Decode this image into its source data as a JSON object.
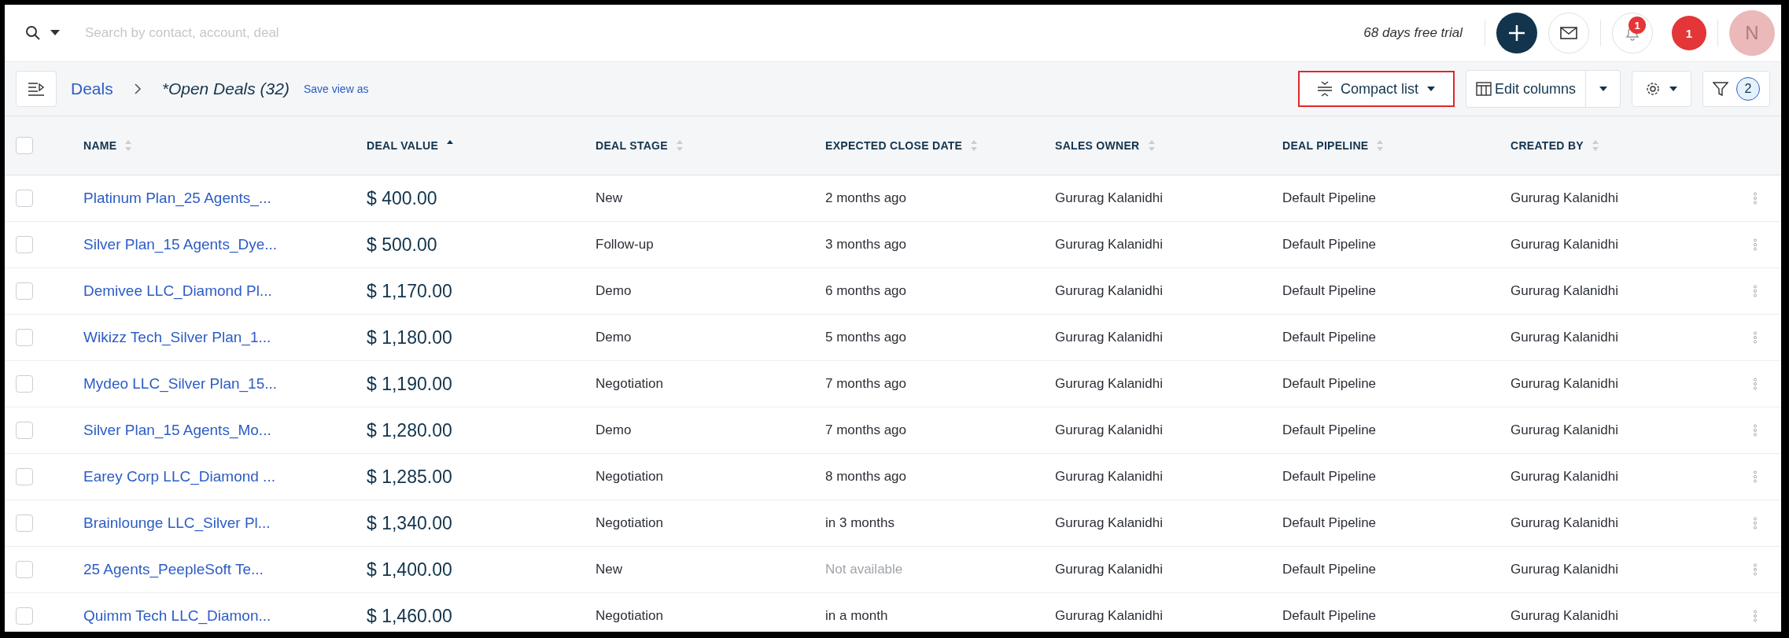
{
  "search": {
    "placeholder": "Search by contact, account, deal"
  },
  "trial_text": "68 days free trial",
  "notifications": {
    "badge": "1"
  },
  "alerts": {
    "count": "1"
  },
  "avatar": {
    "initial": "N"
  },
  "breadcrumb": {
    "module": "Deals",
    "view": "*Open Deals (32)",
    "save_link": "Save view as"
  },
  "toolbar": {
    "view_mode": {
      "label": "Compact list",
      "highlighted": true
    },
    "edit_columns": "Edit columns",
    "filter_count": "2"
  },
  "table": {
    "select_all": {
      "checked": false
    },
    "columns": [
      {
        "label": "NAME",
        "sorted": false
      },
      {
        "label": "DEAL VALUE",
        "sorted": true
      },
      {
        "label": "DEAL STAGE",
        "sorted": false
      },
      {
        "label": "EXPECTED CLOSE DATE",
        "sorted": false
      },
      {
        "label": "SALES OWNER",
        "sorted": false
      },
      {
        "label": "DEAL PIPELINE",
        "sorted": false
      },
      {
        "label": "CREATED BY",
        "sorted": false
      }
    ],
    "rows": [
      {
        "checked": false,
        "name": "Platinum Plan_25 Agents_...",
        "deal_value": "$ 400.00",
        "deal_stage": "New",
        "close_date": {
          "text": "2 months ago",
          "muted": false
        },
        "sales_owner": "Gururag Kalanidhi",
        "pipeline": "Default Pipeline",
        "created_by": "Gururag Kalanidhi"
      },
      {
        "checked": false,
        "name": "Silver Plan_15 Agents_Dye...",
        "deal_value": "$ 500.00",
        "deal_stage": "Follow-up",
        "close_date": {
          "text": "3 months ago",
          "muted": false
        },
        "sales_owner": "Gururag Kalanidhi",
        "pipeline": "Default Pipeline",
        "created_by": "Gururag Kalanidhi"
      },
      {
        "checked": false,
        "name": "Demivee LLC_Diamond Pl...",
        "deal_value": "$ 1,170.00",
        "deal_stage": "Demo",
        "close_date": {
          "text": "6 months ago",
          "muted": false
        },
        "sales_owner": "Gururag Kalanidhi",
        "pipeline": "Default Pipeline",
        "created_by": "Gururag Kalanidhi"
      },
      {
        "checked": false,
        "name": "Wikizz Tech_Silver Plan_1...",
        "deal_value": "$ 1,180.00",
        "deal_stage": "Demo",
        "close_date": {
          "text": "5 months ago",
          "muted": false
        },
        "sales_owner": "Gururag Kalanidhi",
        "pipeline": "Default Pipeline",
        "created_by": "Gururag Kalanidhi"
      },
      {
        "checked": false,
        "name": "Mydeo LLC_Silver Plan_15...",
        "deal_value": "$ 1,190.00",
        "deal_stage": "Negotiation",
        "close_date": {
          "text": "7 months ago",
          "muted": false
        },
        "sales_owner": "Gururag Kalanidhi",
        "pipeline": "Default Pipeline",
        "created_by": "Gururag Kalanidhi"
      },
      {
        "checked": false,
        "name": "Silver Plan_15 Agents_Mo...",
        "deal_value": "$ 1,280.00",
        "deal_stage": "Demo",
        "close_date": {
          "text": "7 months ago",
          "muted": false
        },
        "sales_owner": "Gururag Kalanidhi",
        "pipeline": "Default Pipeline",
        "created_by": "Gururag Kalanidhi"
      },
      {
        "checked": false,
        "name": "Earey Corp LLC_Diamond ...",
        "deal_value": "$ 1,285.00",
        "deal_stage": "Negotiation",
        "close_date": {
          "text": "8 months ago",
          "muted": false
        },
        "sales_owner": "Gururag Kalanidhi",
        "pipeline": "Default Pipeline",
        "created_by": "Gururag Kalanidhi"
      },
      {
        "checked": false,
        "name": "Brainlounge LLC_Silver Pl...",
        "deal_value": "$ 1,340.00",
        "deal_stage": "Negotiation",
        "close_date": {
          "text": "in 3 months",
          "muted": false
        },
        "sales_owner": "Gururag Kalanidhi",
        "pipeline": "Default Pipeline",
        "created_by": "Gururag Kalanidhi"
      },
      {
        "checked": false,
        "name": "25 Agents_PeepleSoft Te...",
        "deal_value": "$ 1,400.00",
        "deal_stage": "New",
        "close_date": {
          "text": "Not available",
          "muted": true
        },
        "sales_owner": "Gururag Kalanidhi",
        "pipeline": "Default Pipeline",
        "created_by": "Gururag Kalanidhi"
      },
      {
        "checked": false,
        "name": "Quimm Tech LLC_Diamon...",
        "deal_value": "$ 1,460.00",
        "deal_stage": "Negotiation",
        "close_date": {
          "text": "in a month",
          "muted": false
        },
        "sales_owner": "Gururag Kalanidhi",
        "pipeline": "Default Pipeline",
        "created_by": "Gururag Kalanidhi"
      }
    ]
  }
}
